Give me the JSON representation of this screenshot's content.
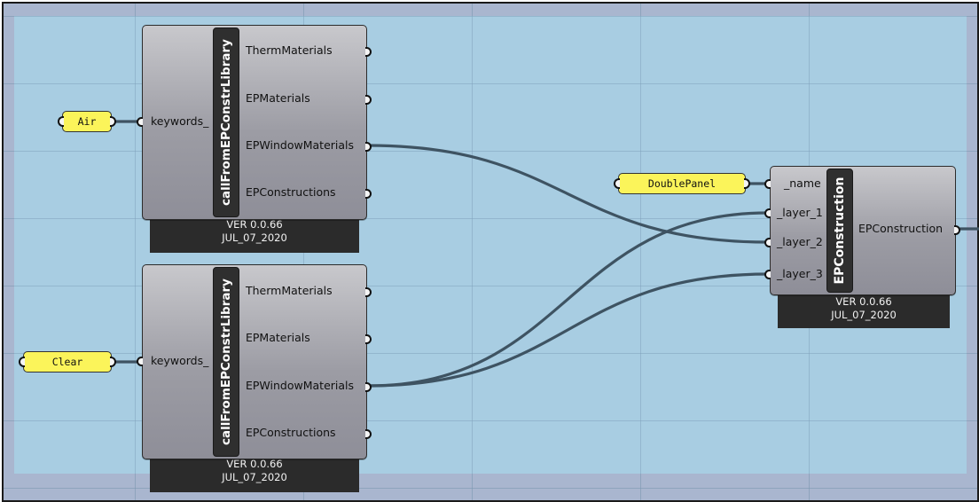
{
  "colors": {
    "canvas_bg": "#a9b6cf",
    "group_bg": "#a8cde2",
    "component_body": "#9c9ca4",
    "panel_yellow": "#fbf45a",
    "wire": "#3e5362",
    "footer": "#2b2b2b"
  },
  "panels": {
    "air": "Air",
    "clear": "Clear",
    "double_panel": "DoublePanel"
  },
  "library_component_1": {
    "name": "callFromEPConstrLibrary",
    "input": "keywords_",
    "outputs": [
      "ThermMaterials",
      "EPMaterials",
      "EPWindowMaterials",
      "EPConstructions"
    ],
    "version": "VER 0.0.66",
    "date": "JUL_07_2020"
  },
  "library_component_2": {
    "name": "callFromEPConstrLibrary",
    "input": "keywords_",
    "outputs": [
      "ThermMaterials",
      "EPMaterials",
      "EPWindowMaterials",
      "EPConstructions"
    ],
    "version": "VER 0.0.66",
    "date": "JUL_07_2020"
  },
  "construction_component": {
    "name": "EPConstruction",
    "inputs": [
      "_name",
      "_layer_1",
      "_layer_2",
      "_layer_3"
    ],
    "output": "EPConstruction",
    "version": "VER 0.0.66",
    "date": "JUL_07_2020"
  }
}
